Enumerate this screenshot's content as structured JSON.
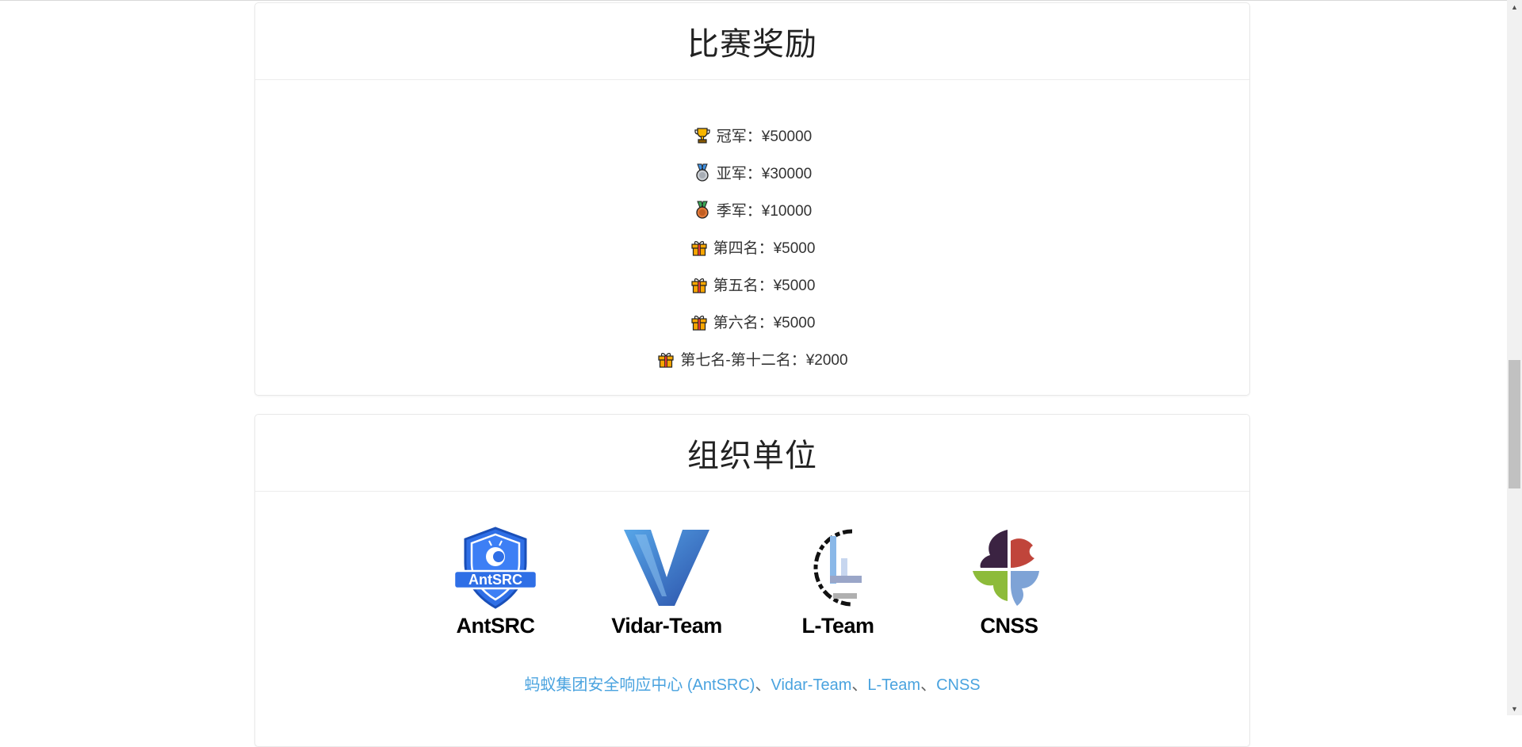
{
  "rewards_section": {
    "title": "比赛奖励",
    "items": [
      {
        "icon": "trophy-icon",
        "text": "冠军：¥50000"
      },
      {
        "icon": "silver-medal-icon",
        "text": "亚军：¥30000"
      },
      {
        "icon": "bronze-medal-icon",
        "text": "季军：¥10000"
      },
      {
        "icon": "gift-icon",
        "text": "第四名：¥5000"
      },
      {
        "icon": "gift-icon",
        "text": "第五名：¥5000"
      },
      {
        "icon": "gift-icon",
        "text": "第六名：¥5000"
      },
      {
        "icon": "gift-icon",
        "text": "第七名-第十二名：¥2000"
      }
    ]
  },
  "organizers_section": {
    "title": "组织单位",
    "logos": [
      {
        "name": "AntSRC",
        "badge_text": "AntSRC"
      },
      {
        "name": "Vidar-Team"
      },
      {
        "name": "L-Team"
      },
      {
        "name": "CNSS"
      }
    ],
    "links": [
      {
        "text": "蚂蚁集团安全响应中心 (AntSRC)"
      },
      {
        "text": "Vidar-Team"
      },
      {
        "text": "L-Team"
      },
      {
        "text": "CNSS"
      }
    ],
    "separator": "、"
  },
  "colors": {
    "link": "#4aa3df",
    "antsrc_blue": "#2f6fe6",
    "vidar_blue": "#3a7bd5"
  }
}
